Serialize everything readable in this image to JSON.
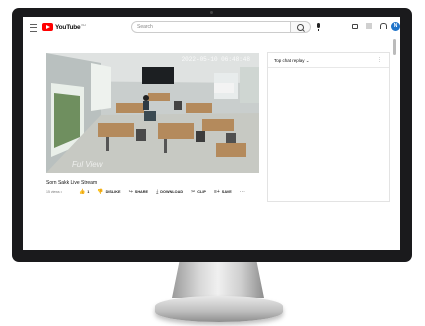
{
  "app": {
    "logo_text": "YouTube",
    "logo_suffix": "KH",
    "search_placeholder": "Search",
    "avatar_letter": "N"
  },
  "video": {
    "timestamp": "2022-05-10 06:48:48",
    "watermark": "Ful View",
    "title": "Sorn Sakk Live Stream",
    "meta": "15 views •"
  },
  "actions": [
    {
      "icon": "like-icon",
      "glyph": "👍",
      "label": "1"
    },
    {
      "icon": "dislike-icon",
      "glyph": "👎",
      "label": "DISLIKE"
    },
    {
      "icon": "share-icon",
      "glyph": "↪",
      "label": "SHARE"
    },
    {
      "icon": "download-icon",
      "glyph": "⤓",
      "label": "DOWNLOAD"
    },
    {
      "icon": "clip-icon",
      "glyph": "✂",
      "label": "CLIP"
    },
    {
      "icon": "save-icon",
      "glyph": "≡+",
      "label": "SAVE"
    },
    {
      "icon": "more-icon",
      "glyph": "⋯",
      "label": ""
    }
  ],
  "chat": {
    "header": "Top chat replay",
    "chevron": "⌄",
    "more": "⋮"
  },
  "colors": {
    "brand": "#ff0000",
    "avatar": "#1e73c9",
    "bezel": "#1a1a1c"
  }
}
